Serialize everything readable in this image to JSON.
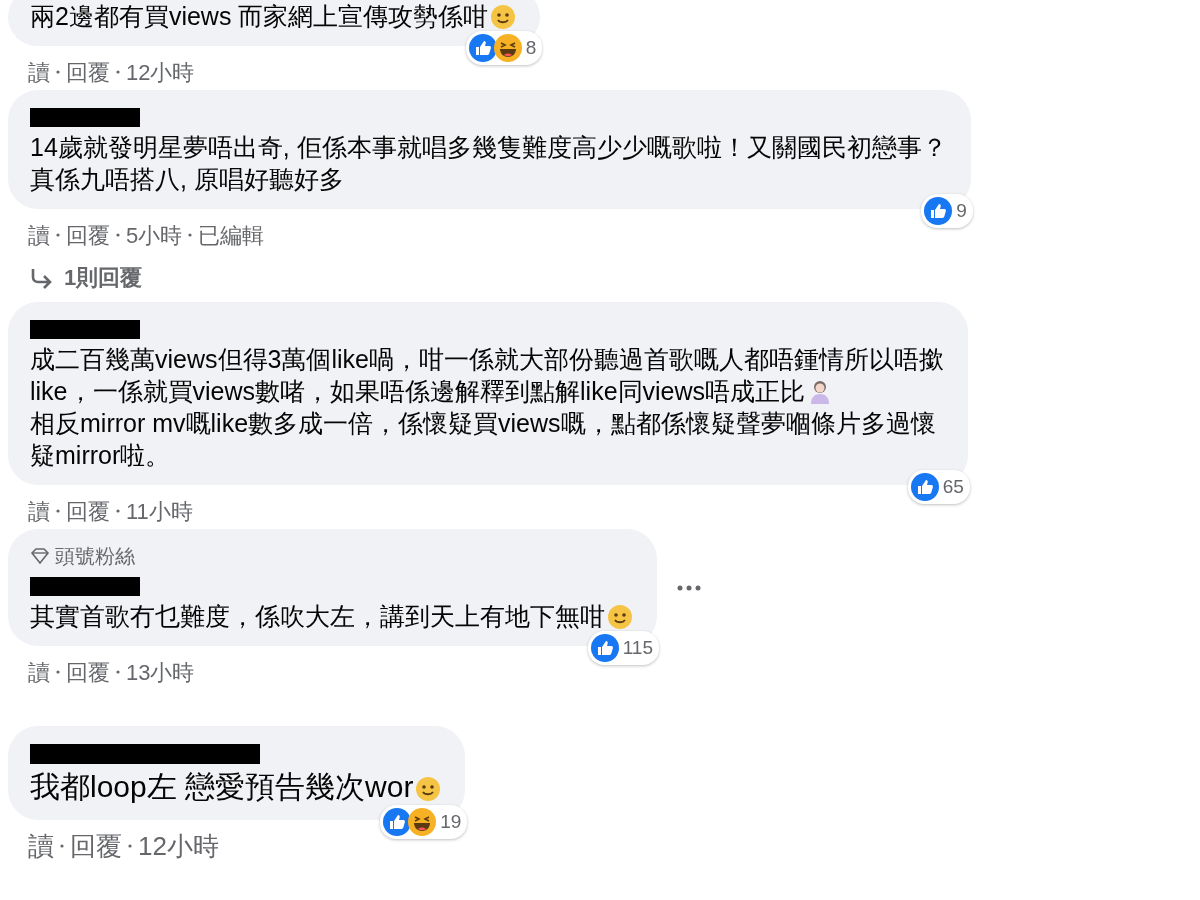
{
  "comments": [
    {
      "body": [
        {
          "kind": "text",
          "text": "兩2邊都有買views 而家網上宣傳攻勢係咁"
        },
        {
          "kind": "face-emoji"
        }
      ],
      "reactions": [
        {
          "kind": "like"
        },
        {
          "kind": "haha"
        }
      ],
      "reaction_count": "8",
      "actions": [
        "讀",
        "回覆"
      ],
      "time": "12小時"
    },
    {
      "author_redacted": true,
      "body": [
        {
          "kind": "text",
          "text": "14歲就發明星夢唔出奇, 佢係本事就唱多幾隻難度高少少嘅歌啦！又關國民初戀事？"
        },
        {
          "kind": "text",
          "text": "真係九唔搭八, 原唱好聽好多"
        }
      ],
      "reactions": [
        {
          "kind": "like"
        }
      ],
      "reaction_count": "9",
      "actions": [
        "讀",
        "回覆"
      ],
      "time": "5小時",
      "edited": "已編輯",
      "replies": "1則回覆"
    },
    {
      "author_redacted": true,
      "body": [
        {
          "kind": "text",
          "text": "成二百幾萬views但得3萬個like喎，咁一係就大部份聽過首歌嘅人都唔鍾情所以唔撳"
        },
        {
          "kind": "text",
          "text": "like，一係就買views數啫，如果唔係邊解釋到點解like同views唔成正比"
        },
        {
          "kind": "person-emoji"
        },
        {
          "kind": "text",
          "text": "相反mirror mv嘅like數多成一倍，係懷疑買views嘅，點都係懷疑聲夢嗰條片多過懷"
        },
        {
          "kind": "text",
          "text": "疑mirror啦。"
        }
      ],
      "reactions": [
        {
          "kind": "like"
        }
      ],
      "reaction_count": "65",
      "actions": [
        "讀",
        "回覆"
      ],
      "time": "11小時"
    },
    {
      "badge": "頭號粉絲",
      "author_redacted": true,
      "more_menu": true,
      "body": [
        {
          "kind": "text",
          "text": "其實首歌冇乜難度，係吹大左，講到天上有地下無咁"
        },
        {
          "kind": "face-emoji"
        }
      ],
      "reactions": [
        {
          "kind": "like"
        }
      ],
      "reaction_count": "115",
      "actions": [
        "讀",
        "回覆"
      ],
      "time": "13小時"
    },
    {
      "author_redacted": true,
      "body": [
        {
          "kind": "text",
          "text": "我都loop左 戀愛預告幾次wor"
        },
        {
          "kind": "face-emoji"
        }
      ],
      "reactions": [
        {
          "kind": "like"
        },
        {
          "kind": "haha"
        }
      ],
      "reaction_count": "19",
      "actions": [
        "讀",
        "回覆"
      ],
      "time": "12小時"
    }
  ]
}
